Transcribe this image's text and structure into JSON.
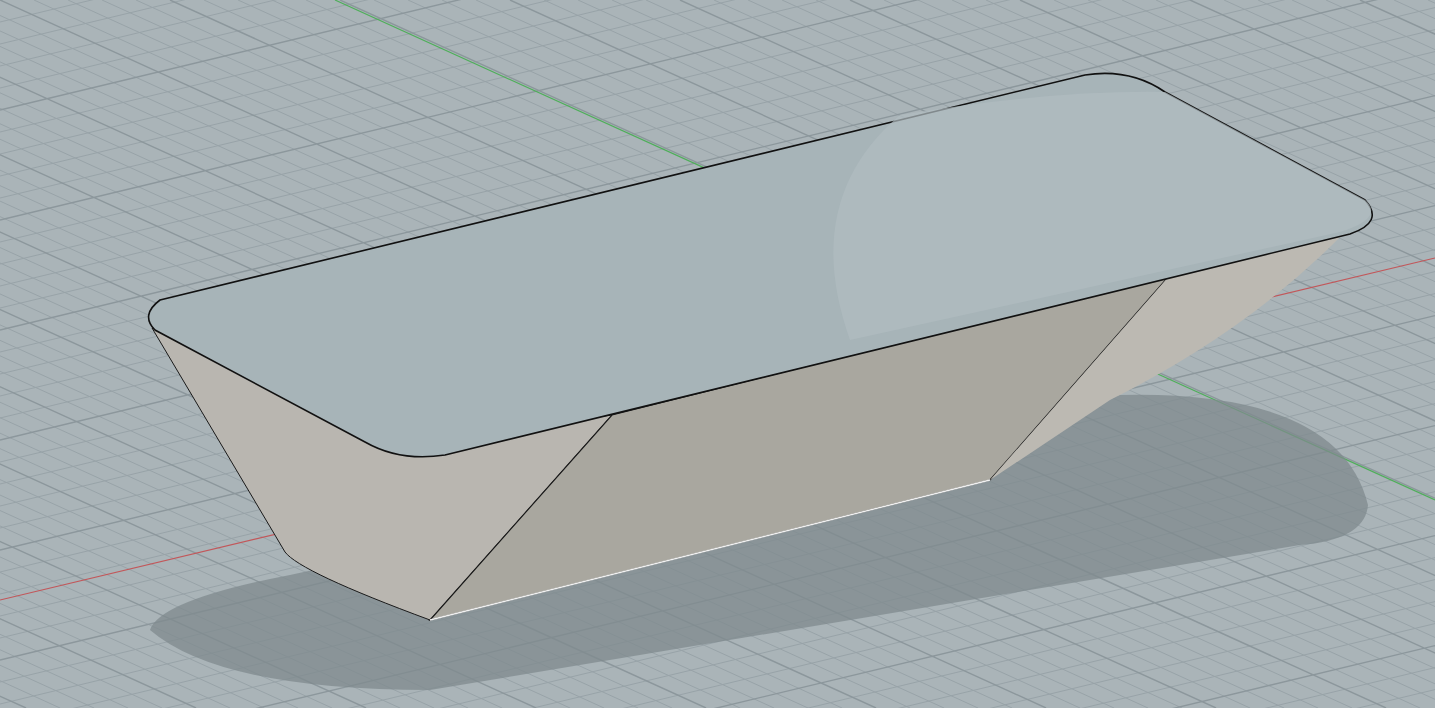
{
  "viewport": {
    "grid_visible": true,
    "axes_visible": true,
    "shadow_visible": true
  }
}
